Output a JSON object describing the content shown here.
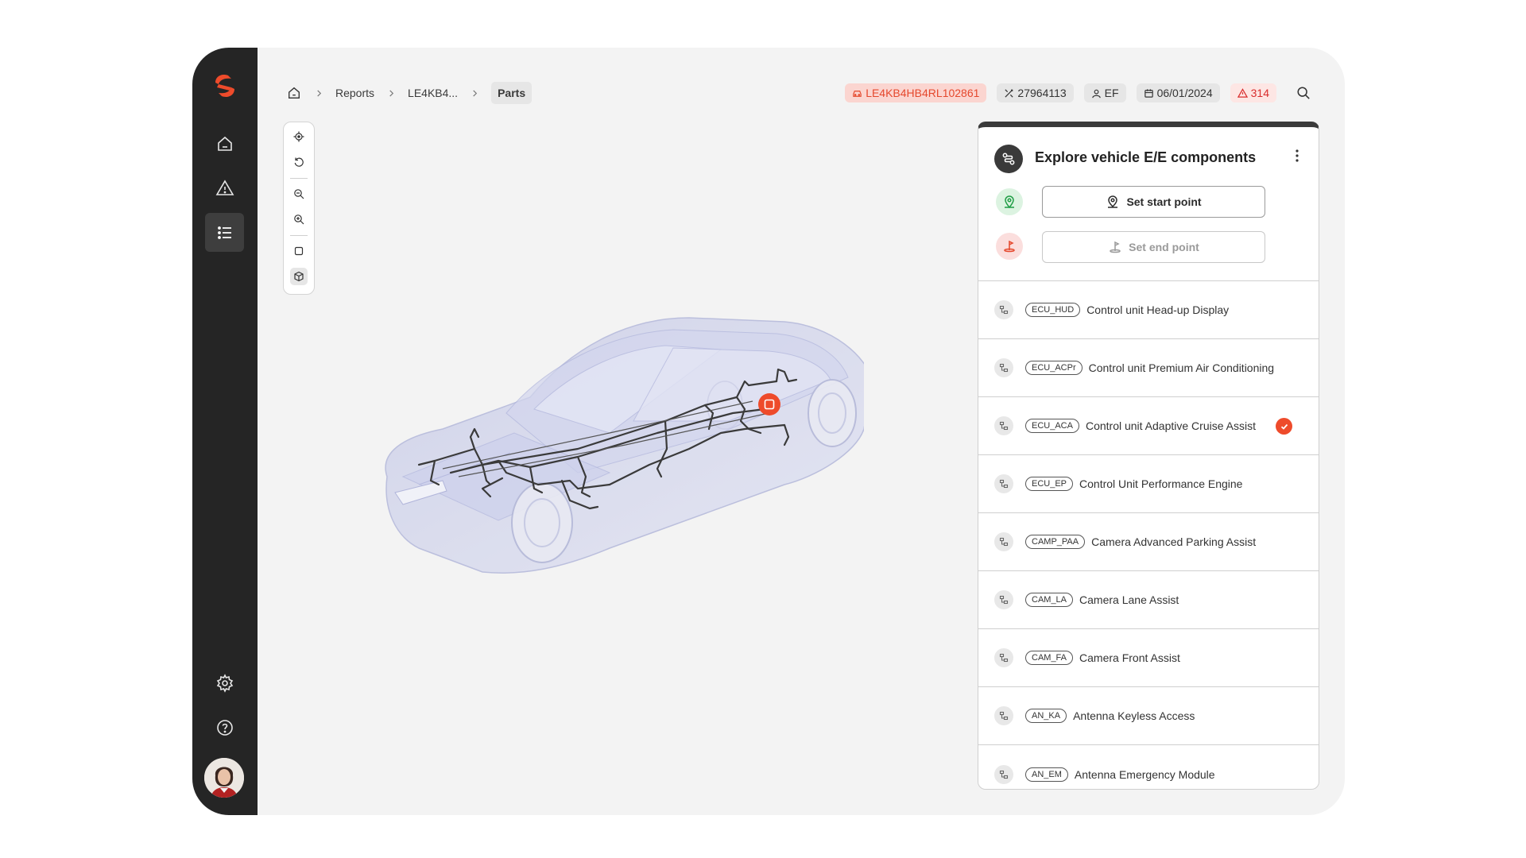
{
  "breadcrumb": {
    "home_icon": "home-icon",
    "items": [
      "Reports",
      "LE4KB4...",
      "Parts"
    ]
  },
  "vehicle_info": {
    "vin": "LE4KB4HB4RL102861",
    "order_id": "27964113",
    "user": "EF",
    "date": "06/01/2024",
    "alerts": "314"
  },
  "panel": {
    "title": "Explore vehicle E/E components",
    "start_point_label": "Set start point",
    "end_point_label": "Set end point",
    "components": [
      {
        "code": "ECU_HUD",
        "name": "Control unit Head-up Display",
        "selected": false
      },
      {
        "code": "ECU_ACPr",
        "name": "Control unit Premium Air Conditioning",
        "selected": false
      },
      {
        "code": "ECU_ACA",
        "name": "Control unit Adaptive Cruise Assist",
        "selected": true
      },
      {
        "code": "ECU_EP",
        "name": "Control Unit Performance Engine",
        "selected": false
      },
      {
        "code": "CAMP_PAA",
        "name": "Camera Advanced Parking Assist",
        "selected": false
      },
      {
        "code": "CAM_LA",
        "name": "Camera Lane Assist",
        "selected": false
      },
      {
        "code": "CAM_FA",
        "name": "Camera Front Assist",
        "selected": false
      },
      {
        "code": "AN_KA",
        "name": "Antenna Keyless Access",
        "selected": false
      },
      {
        "code": "AN_EM",
        "name": "Antenna Emergency Module",
        "selected": false
      }
    ]
  },
  "colors": {
    "accent": "#ee4b2b",
    "sidebar": "#252525",
    "canvas": "#f3f3f3"
  }
}
